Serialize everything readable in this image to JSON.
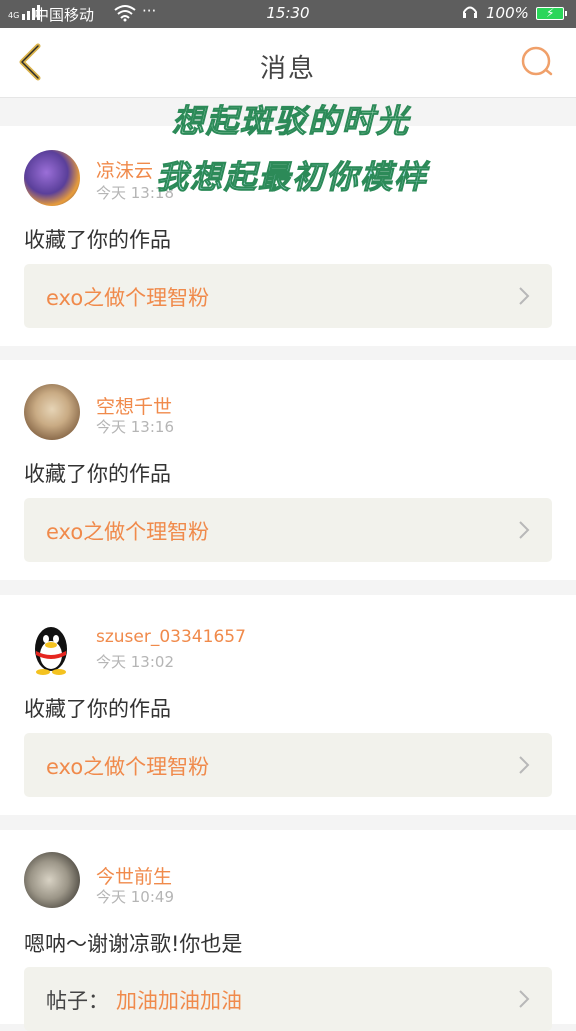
{
  "status_bar": {
    "network": "4G",
    "carrier": "中国移动",
    "wifi_icon": "wifi-icon",
    "more_dots": "···",
    "time": "15:30",
    "headphone_icon": "headphone-icon",
    "battery_percent": "100%",
    "battery_icon": "battery-charging-icon"
  },
  "nav": {
    "title": "消息",
    "back_icon": "chevron-left-icon",
    "search_icon": "search-icon",
    "accent_color": "#f0a06a"
  },
  "overlay": {
    "line1": "想起斑驳的时光",
    "line2": "我想起最初你模样"
  },
  "messages": [
    {
      "username": "凉沫云",
      "time": "今天 13:18",
      "text": "收藏了你的作品",
      "work_title": "exo之做个理智粉"
    },
    {
      "username": "空想千世",
      "time": "今天 13:16",
      "text": "收藏了你的作品",
      "work_title": "exo之做个理智粉"
    },
    {
      "username": "szuser_03341657",
      "time": "今天 13:02",
      "text": "收藏了你的作品",
      "work_title": "exo之做个理智粉"
    },
    {
      "username": "今世前生",
      "time": "今天 10:49",
      "text": "嗯呐～谢谢凉歌!你也是",
      "post_prefix": "帖子：",
      "post_title": "加油加油加油"
    }
  ],
  "colors": {
    "username": "#f08a4b",
    "timestamp": "#b5b5b5",
    "box_bg": "#f2f2ec",
    "page_bg": "#f4f4f4"
  }
}
